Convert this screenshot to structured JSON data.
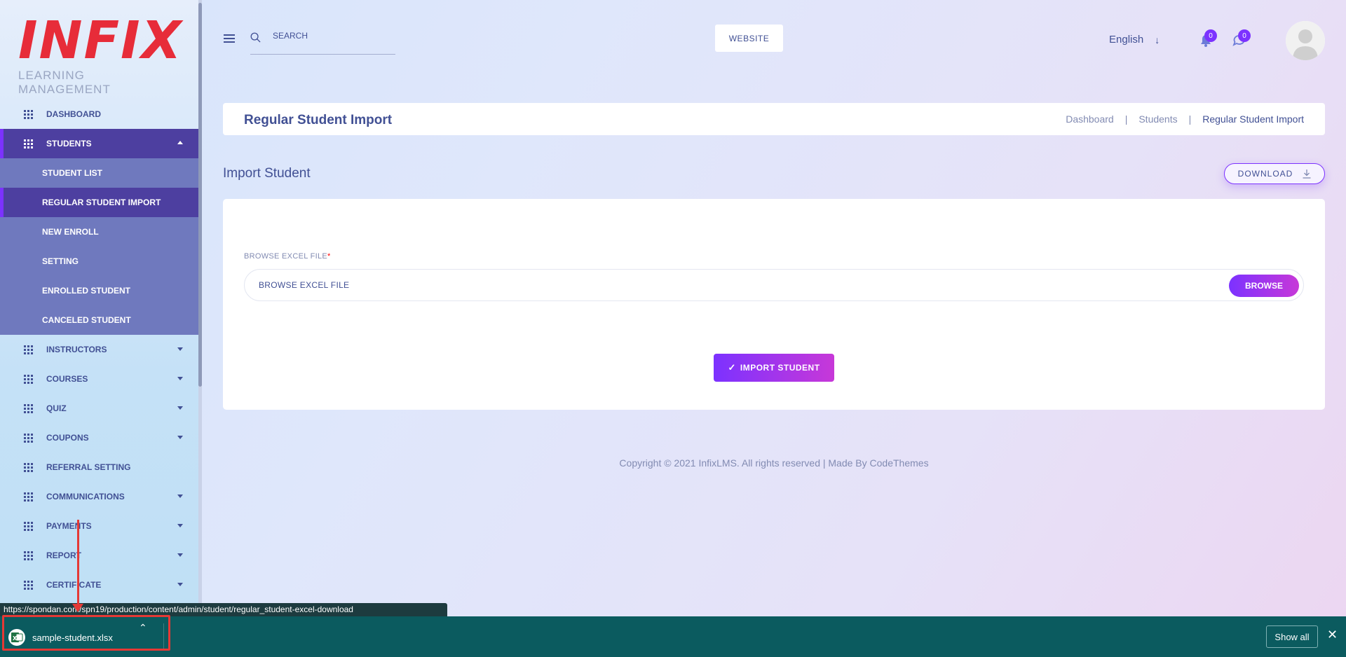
{
  "logo": {
    "word": "INFIX",
    "subtitle": "LEARNING MANAGEMENT"
  },
  "sidebar": {
    "items": [
      {
        "label": "DASHBOARD"
      },
      {
        "label": "STUDENTS"
      },
      {
        "label": "INSTRUCTORS"
      },
      {
        "label": "COURSES"
      },
      {
        "label": "QUIZ"
      },
      {
        "label": "COUPONS"
      },
      {
        "label": "REFERRAL SETTING"
      },
      {
        "label": "COMMUNICATIONS"
      },
      {
        "label": "PAYMENTS"
      },
      {
        "label": "REPORT"
      },
      {
        "label": "CERTIFICATE"
      }
    ],
    "students_submenu": [
      {
        "label": "STUDENT LIST"
      },
      {
        "label": "REGULAR STUDENT IMPORT"
      },
      {
        "label": "NEW ENROLL"
      },
      {
        "label": "SETTING"
      },
      {
        "label": "ENROLLED STUDENT"
      },
      {
        "label": "CANCELED STUDENT"
      }
    ]
  },
  "header": {
    "search_placeholder": "SEARCH",
    "website_label": "WEBSITE",
    "language": "English",
    "notifications_count": "0",
    "messages_count": "0"
  },
  "title_bar": {
    "title": "Regular Student Import",
    "breadcrumb": [
      "Dashboard",
      "Students",
      "Regular Student Import"
    ],
    "separator": "|"
  },
  "section": {
    "title": "Import Student",
    "download_label": "DOWNLOAD"
  },
  "form": {
    "field_label": "BROWSE EXCEL FILE",
    "required_mark": "*",
    "file_placeholder": "BROWSE  EXCEL FILE",
    "browse_label": "BROWSE",
    "import_label": "IMPORT STUDENT",
    "import_check": "✓"
  },
  "footer": {
    "copyright": "Copyright © 2021 InfixLMS. All rights reserved | Made By CodeThemes"
  },
  "browser": {
    "status_url": "https://spondan.com/spn19/production/content/admin/student/regular_student-excel-download",
    "download_filename": "sample-student.xlsx",
    "show_all_label": "Show all"
  },
  "colors": {
    "accent": "#7c32ff",
    "brand_red": "#e72c39",
    "nav_active": "#4d3fa0",
    "download_bar": "#0b5b5f",
    "annotation": "#e53935"
  },
  "icons": [
    "grid-icon",
    "caret-down-icon",
    "caret-up-icon",
    "hamburger-icon",
    "search-icon",
    "arrow-down-icon",
    "bell-icon",
    "chat-icon",
    "avatar-icon",
    "download-icon",
    "excel-file-icon",
    "chevron-up-icon",
    "close-icon"
  ]
}
